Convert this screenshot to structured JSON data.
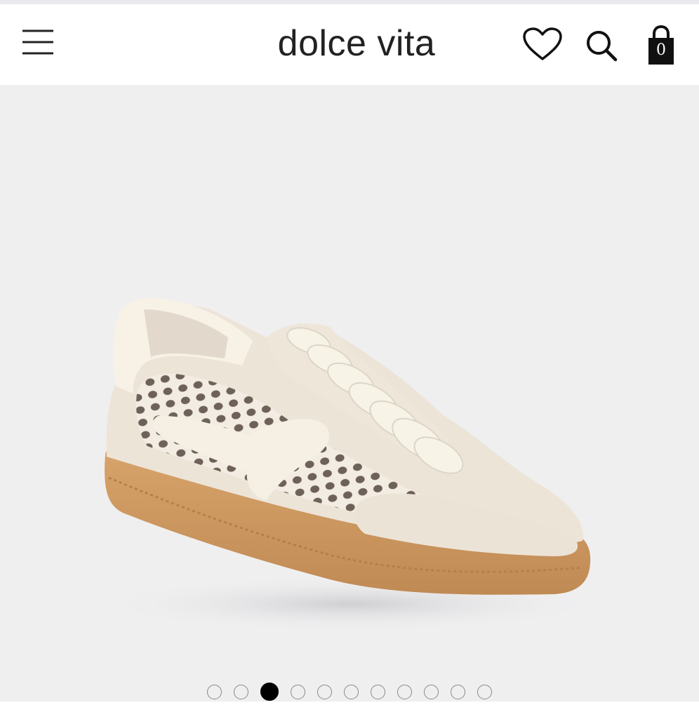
{
  "header": {
    "brand": "dolce vita",
    "bag_count": "0",
    "icons": {
      "menu": "hamburger-menu-icon",
      "wishlist": "heart-icon",
      "search": "search-icon",
      "bag": "shopping-bag-icon"
    }
  },
  "gallery": {
    "image": "product-photo-sneaker",
    "slide_count": 11,
    "active_slide": 3
  },
  "colors": {
    "header_bg": "#ffffff",
    "gallery_bg": "#efeff0",
    "text": "#222222",
    "sole": "#cd9a61",
    "upper": "#f3ebe0"
  }
}
